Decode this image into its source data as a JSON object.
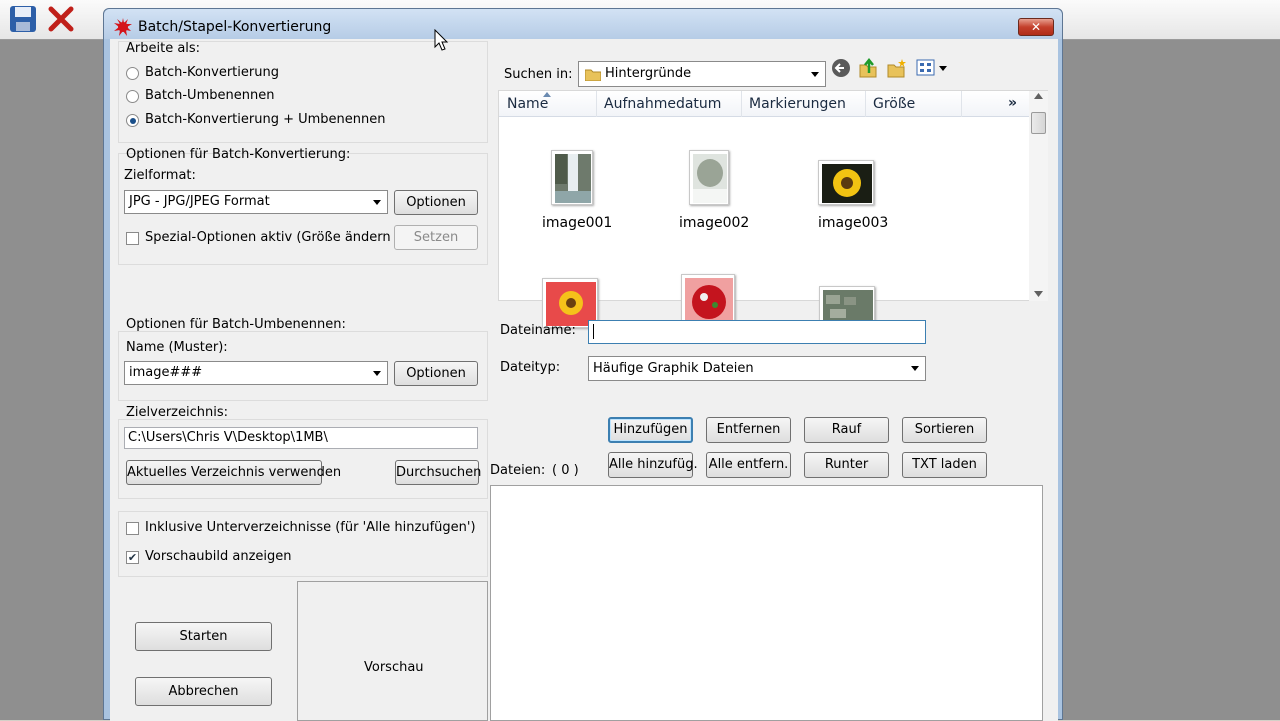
{
  "dialog": {
    "title": "Batch/Stapel-Konvertierung",
    "close_label": "✕"
  },
  "work_mode": {
    "label": "Arbeite als:",
    "options": [
      "Batch-Konvertierung",
      "Batch-Umbenennen",
      "Batch-Konvertierung + Umbenennen"
    ],
    "selected_index": 2
  },
  "conversion": {
    "label": "Optionen für Batch-Konvertierung:",
    "format_label": "Zielformat:",
    "format_value": "JPG - JPG/JPEG Format",
    "options_button": "Optionen",
    "special_label": "Spezial-Optionen aktiv (Größe ändern etc.)",
    "special_checked": false,
    "set_button": "Setzen"
  },
  "rename": {
    "label": "Optionen für Batch-Umbenennen:",
    "pattern_label": "Name (Muster):",
    "pattern_value": "image###",
    "options_button": "Optionen"
  },
  "target": {
    "label": "Zielverzeichnis:",
    "path": "C:\\Users\\Chris V\\Desktop\\1MB\\",
    "use_current_button": "Aktuelles Verzeichnis verwenden",
    "browse_button": "Durchsuchen"
  },
  "include_subdirs": {
    "label": "Inklusive Unterverzeichnisse (für 'Alle hinzufügen')",
    "checked": false
  },
  "show_preview": {
    "label": "Vorschaubild anzeigen",
    "checked": true
  },
  "actions": {
    "start": "Starten",
    "cancel": "Abbrechen"
  },
  "preview_label": "Vorschau",
  "browser": {
    "look_in_label": "Suchen in:",
    "look_in_value": "Hintergründe",
    "columns": [
      "Name",
      "Aufnahmedatum",
      "Markierungen",
      "Größe"
    ],
    "more_columns": "»",
    "files": [
      {
        "name": "image001",
        "icon": "waterfall-thumbnail"
      },
      {
        "name": "image002",
        "icon": "snow-tree-thumbnail"
      },
      {
        "name": "image003",
        "icon": "sunflower-thumbnail"
      },
      {
        "name": "",
        "icon": "sunflower-red-thumbnail"
      },
      {
        "name": "",
        "icon": "red-flowers-thumbnail"
      },
      {
        "name": "",
        "icon": "stone-wall-thumbnail"
      }
    ],
    "filename_label": "Dateiname:",
    "filename_value": "",
    "filetype_label": "Dateityp:",
    "filetype_value": "Häufige Graphik Dateien"
  },
  "list_buttons": {
    "add": "Hinzufügen",
    "remove": "Entfernen",
    "up": "Rauf",
    "sort": "Sortieren",
    "add_all": "Alle hinzufüg.",
    "remove_all": "Alle entfern.",
    "down": "Runter",
    "load_txt": "TXT laden"
  },
  "files_label": "Dateien:",
  "files_count": "( 0 )"
}
